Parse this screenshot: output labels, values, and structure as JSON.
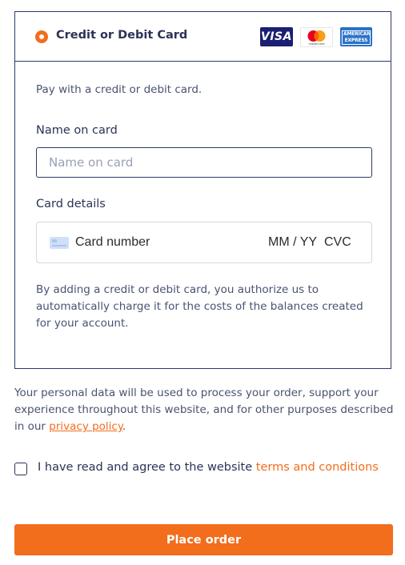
{
  "payment_method": {
    "label": "Credit or Debit Card",
    "selected": true,
    "logos": {
      "visa": "VISA",
      "mastercard": "mastercard",
      "amex_line1": "AMERICAN",
      "amex_line2": "EXPRESS"
    },
    "description": "Pay with a credit or debit card.",
    "name_field": {
      "label": "Name on card",
      "placeholder": "Name on card",
      "value": ""
    },
    "card_details": {
      "label": "Card details",
      "number_placeholder": "Card number",
      "expiry_placeholder": "MM / YY",
      "cvc_placeholder": "CVC"
    },
    "authorization_text": "By adding a credit or debit card, you authorize us to automatically charge it for the costs of the balances created for your account."
  },
  "privacy": {
    "text_before": "Your personal data will be used to process your order, support your experience throughout this website, and for other purposes described in our ",
    "link": "privacy policy",
    "text_after": "."
  },
  "terms": {
    "text": "I have read and agree to the website ",
    "link": "terms and conditions",
    "checked": false
  },
  "place_order": {
    "label": "Place order"
  },
  "colors": {
    "accent": "#f26d1c",
    "border": "#2d3a6b",
    "text": "#2b3356",
    "visa_blue": "#1a1f71",
    "amex_blue": "#2a72c8"
  }
}
